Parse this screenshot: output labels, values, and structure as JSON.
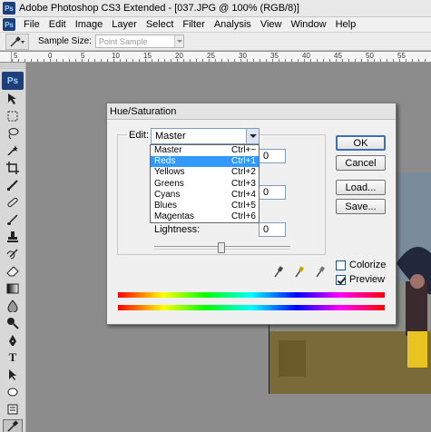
{
  "window": {
    "title": "Adobe Photoshop CS3 Extended - [037.JPG @ 100% (RGB/8)]",
    "logo": "Ps"
  },
  "menu": {
    "items": [
      "File",
      "Edit",
      "Image",
      "Layer",
      "Select",
      "Filter",
      "Analysis",
      "View",
      "Window",
      "Help"
    ]
  },
  "options": {
    "sample_size_label": "Sample Size:",
    "sample_size_value": "Point Sample"
  },
  "ruler": {
    "labels": [
      "5",
      "0",
      "5",
      "10",
      "15",
      "20",
      "25",
      "30",
      "35",
      "40",
      "45",
      "50",
      "55"
    ]
  },
  "toolbox": {
    "badge": "Ps",
    "tools": [
      "move-tool",
      "marquee-tool",
      "lasso-tool",
      "magic-wand-tool",
      "crop-tool",
      "slice-tool",
      "healing-brush-tool",
      "brush-tool",
      "clone-stamp-tool",
      "history-brush-tool",
      "eraser-tool",
      "gradient-tool",
      "blur-tool",
      "dodge-tool",
      "pen-tool",
      "type-tool",
      "path-selection-tool",
      "shape-tool",
      "notes-tool",
      "eyedropper-tool",
      "hand-tool"
    ]
  },
  "dialog": {
    "title": "Hue/Saturation",
    "edit_label": "Edit:",
    "edit_value": "Master",
    "dropdown": [
      {
        "label": "Master",
        "shortcut": "Ctrl+~",
        "selected": false
      },
      {
        "label": "Reds",
        "shortcut": "Ctrl+1",
        "selected": true
      },
      {
        "label": "Yellows",
        "shortcut": "Ctrl+2",
        "selected": false
      },
      {
        "label": "Greens",
        "shortcut": "Ctrl+3",
        "selected": false
      },
      {
        "label": "Cyans",
        "shortcut": "Ctrl+4",
        "selected": false
      },
      {
        "label": "Blues",
        "shortcut": "Ctrl+5",
        "selected": false
      },
      {
        "label": "Magentas",
        "shortcut": "Ctrl+6",
        "selected": false
      }
    ],
    "hue_value": "0",
    "saturation_value": "0",
    "lightness_label": "Lightness:",
    "lightness_value": "0",
    "buttons": {
      "ok": "OK",
      "cancel": "Cancel",
      "load": "Load...",
      "save": "Save..."
    },
    "colorize_label": "Colorize",
    "colorize_checked": false,
    "preview_label": "Preview",
    "preview_checked": true
  },
  "colors": {
    "menu_highlight": "#3399ff",
    "photoshop_blue": "#1e3f7a"
  }
}
